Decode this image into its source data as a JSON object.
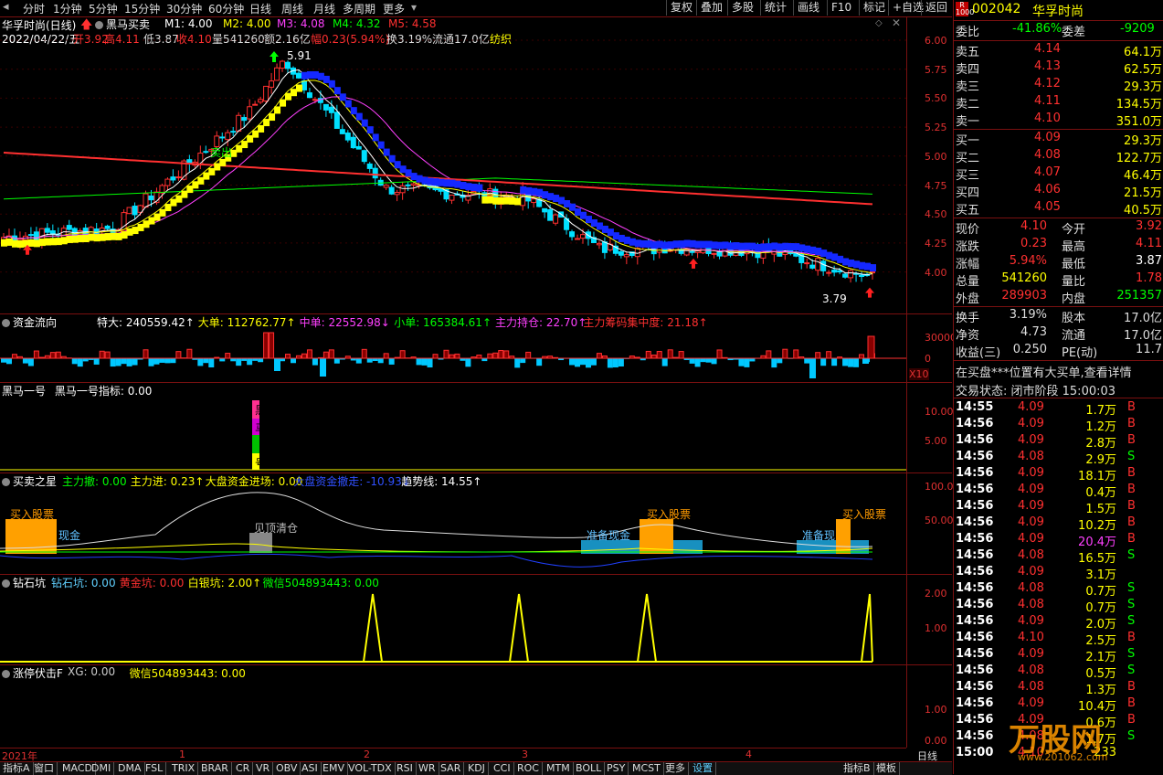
{
  "top_tabs": [
    "分时",
    "1分钟",
    "5分钟",
    "15分钟",
    "30分钟",
    "60分钟",
    "日线",
    "周线",
    "月线",
    "多周期",
    "更多"
  ],
  "top_right_buttons": [
    "复权",
    "叠加",
    "多股",
    "统计",
    "画线",
    "F10",
    "标记",
    "+自选",
    "返回"
  ],
  "stock_title": "华孚时尚(日线)",
  "indicator_name": "黑马买卖",
  "ma_labels": [
    {
      "text": "M1: 4.00",
      "color": "#ffffff"
    },
    {
      "text": "M2: 4.00",
      "color": "#ffff00"
    },
    {
      "text": "M3: 4.08",
      "color": "#ff40ff"
    },
    {
      "text": "M4: 4.32",
      "color": "#00ff00"
    },
    {
      "text": "M5: 4.58",
      "color": "#ff3030"
    }
  ],
  "info_line": {
    "date": "2022/04/22/五",
    "open": "开3.92",
    "high": "高4.11",
    "low": "低3.87",
    "close": "收4.10",
    "vol": "量541260",
    "amount": "额2.16亿",
    "change": "幅0.23(5.94%)",
    "turnover": "换3.19%",
    "float": "流通17.0亿",
    "industry": "纺织"
  },
  "main_axis": [
    "6.00",
    "5.75",
    "5.50",
    "5.25",
    "5.00",
    "4.75",
    "4.50",
    "4.25",
    "4.00"
  ],
  "price_annotations": {
    "high": "5.91",
    "low": "3.79",
    "sell_tag": "卖出"
  },
  "panel_zjlx": {
    "title": "资金流向",
    "items": [
      {
        "text": "特大: 240559.42↑",
        "color": "#ffffff"
      },
      {
        "text": "大单: 112762.77↑",
        "color": "#ffff00"
      },
      {
        "text": "中单: 22552.98↓",
        "color": "#ff40ff"
      },
      {
        "text": "小单: 165384.61↑",
        "color": "#00ff00"
      },
      {
        "text": "主力持仓: 22.70↑",
        "color": "#ff40ff"
      },
      {
        "text": "主力筹码集中度: 21.18↑",
        "color": "#ff3030"
      }
    ],
    "axis": [
      "30000",
      "0"
    ],
    "scale": "X10"
  },
  "panel_hm": {
    "title": "黑马一号",
    "label": "黑马一号指标: 0.00",
    "axis": [
      "10.00",
      "5.00"
    ],
    "tag_chars": [
      "黑",
      "马",
      "号"
    ]
  },
  "panel_mmzx": {
    "title": "买卖之星",
    "items": [
      {
        "text": "主力撤: 0.00",
        "color": "#00ff00"
      },
      {
        "text": "主力进: 0.23↑",
        "color": "#ffff00"
      },
      {
        "text": "大盘资金进场: 0.00",
        "color": "#ffff00"
      },
      {
        "text": "大盘资金撤走: -10.93↓",
        "color": "#3050ff"
      },
      {
        "text": "趋势线: 14.55↑",
        "color": "#ffffff"
      }
    ],
    "axis": [
      "100.00",
      "50.00"
    ],
    "labels": {
      "buy": "买入股票",
      "cash": "准备现金",
      "cash_short": "准备现",
      "cash_frag": "现金",
      "clear": "见顶清仓"
    }
  },
  "panel_zsk": {
    "title": "钻石坑",
    "items": [
      {
        "text": "钻石坑: 0.00",
        "color": "#60d0ff"
      },
      {
        "text": "黄金坑: 0.00",
        "color": "#ff3030"
      },
      {
        "text": "白银坑: 2.00↑",
        "color": "#ffff00"
      },
      {
        "text": "微信504893443: 0.00",
        "color": "#00ff00"
      }
    ],
    "axis": [
      "2.00",
      "1.00"
    ]
  },
  "panel_ztfj": {
    "title": "涨停伏击F",
    "items": [
      {
        "text": "XG: 0.00",
        "color": "#cccccc"
      },
      {
        "text": "微信504893443: 0.00",
        "color": "#ffff00"
      }
    ],
    "axis": [
      "1.00",
      "0.00"
    ]
  },
  "time_scale": {
    "year": "2021年",
    "months": [
      "1",
      "2",
      "3",
      "4"
    ],
    "period": "日线"
  },
  "bottom_tabs": [
    "指标A",
    "窗口",
    "MACD",
    "DMI",
    "DMA",
    "FSL",
    "TRIX",
    "BRAR",
    "CR",
    "VR",
    "OBV",
    "ASI",
    "EMV",
    "VOL-TDX",
    "RSI",
    "WR",
    "SAR",
    "KDJ",
    "CCI",
    "ROC",
    "MTM",
    "BOLL",
    "PSY",
    "MCST",
    "更多",
    "设置",
    "指标B",
    "模板"
  ],
  "right_panel": {
    "code": "002042",
    "name": "华孚时尚",
    "weibi": {
      "label": "委比",
      "value": "-41.86%",
      "label2": "委差",
      "value2": "-9209"
    },
    "sell": [
      {
        "label": "卖五",
        "price": "4.14",
        "vol": "64.1万"
      },
      {
        "label": "卖四",
        "price": "4.13",
        "vol": "62.5万"
      },
      {
        "label": "卖三",
        "price": "4.12",
        "vol": "29.3万"
      },
      {
        "label": "卖二",
        "price": "4.11",
        "vol": "134.5万"
      },
      {
        "label": "卖一",
        "price": "4.10",
        "vol": "351.0万"
      }
    ],
    "buy": [
      {
        "label": "买一",
        "price": "4.09",
        "vol": "29.3万"
      },
      {
        "label": "买二",
        "price": "4.08",
        "vol": "122.7万"
      },
      {
        "label": "买三",
        "price": "4.07",
        "vol": "46.4万"
      },
      {
        "label": "买四",
        "price": "4.06",
        "vol": "21.5万"
      },
      {
        "label": "买五",
        "price": "4.05",
        "vol": "40.5万"
      }
    ],
    "stats": [
      {
        "l1": "现价",
        "v1": "4.10",
        "c1": "#ff3030",
        "l2": "今开",
        "v2": "3.92",
        "c2": "#ff3030"
      },
      {
        "l1": "涨跌",
        "v1": "0.23",
        "c1": "#ff3030",
        "l2": "最高",
        "v2": "4.11",
        "c2": "#ff3030"
      },
      {
        "l1": "涨幅",
        "v1": "5.94%",
        "c1": "#ff3030",
        "l2": "最低",
        "v2": "3.87",
        "c2": "#ffffff"
      },
      {
        "l1": "总量",
        "v1": "541260",
        "c1": "#ffff00",
        "l2": "量比",
        "v2": "1.78",
        "c2": "#ff3030"
      },
      {
        "l1": "外盘",
        "v1": "289903",
        "c1": "#ff3030",
        "l2": "内盘",
        "v2": "251357",
        "c2": "#00ff00"
      }
    ],
    "stats2": [
      {
        "l1": "换手",
        "v1": "3.19%",
        "l2": "股本",
        "v2": "17.0亿"
      },
      {
        "l1": "净资",
        "v1": "4.73",
        "l2": "流通",
        "v2": "17.0亿"
      },
      {
        "l1": "收益(三)",
        "v1": "0.250",
        "l2": "PE(动)",
        "v2": "11.7"
      }
    ],
    "notice": "在买盘***位置有大买单,查看详情",
    "trade_state": "交易状态: 闭市阶段 15:00:03",
    "ticks": [
      {
        "t": "14:55",
        "p": "4.09",
        "v": "1.7万",
        "s": "B"
      },
      {
        "t": "14:56",
        "p": "4.09",
        "v": "1.2万",
        "s": "B"
      },
      {
        "t": "14:56",
        "p": "4.09",
        "v": "2.8万",
        "s": "B"
      },
      {
        "t": "14:56",
        "p": "4.08",
        "v": "2.9万",
        "s": "S"
      },
      {
        "t": "14:56",
        "p": "4.09",
        "v": "18.1万",
        "s": "B"
      },
      {
        "t": "14:56",
        "p": "4.09",
        "v": "0.4万",
        "s": "B"
      },
      {
        "t": "14:56",
        "p": "4.09",
        "v": "1.5万",
        "s": "B"
      },
      {
        "t": "14:56",
        "p": "4.09",
        "v": "10.2万",
        "s": "B"
      },
      {
        "t": "14:56",
        "p": "4.09",
        "v": "20.4万",
        "s": "B"
      },
      {
        "t": "14:56",
        "p": "4.08",
        "v": "16.5万",
        "s": "S"
      },
      {
        "t": "14:56",
        "p": "4.09",
        "v": "3.1万",
        "s": ""
      },
      {
        "t": "14:56",
        "p": "4.08",
        "v": "0.7万",
        "s": "S"
      },
      {
        "t": "14:56",
        "p": "4.08",
        "v": "0.7万",
        "s": "S"
      },
      {
        "t": "14:56",
        "p": "4.09",
        "v": "2.0万",
        "s": "S"
      },
      {
        "t": "14:56",
        "p": "4.10",
        "v": "2.5万",
        "s": "B"
      },
      {
        "t": "14:56",
        "p": "4.09",
        "v": "2.1万",
        "s": "S"
      },
      {
        "t": "14:56",
        "p": "4.08",
        "v": "0.5万",
        "s": "S"
      },
      {
        "t": "14:56",
        "p": "4.08",
        "v": "1.3万",
        "s": "B"
      },
      {
        "t": "14:56",
        "p": "4.09",
        "v": "10.4万",
        "s": "B"
      },
      {
        "t": "14:56",
        "p": "4.09",
        "v": "0.6万",
        "s": "B"
      },
      {
        "t": "14:56",
        "p": "4.08",
        "v": "1.7万",
        "s": "S"
      },
      {
        "t": "15:00",
        "p": "4.10",
        "v": "233",
        "s": ""
      }
    ]
  },
  "watermark": "万股网",
  "watermark_url": "www.201062.com",
  "colors": {
    "up": "#ff3030",
    "down": "#00e0ff",
    "ma1": "#ffffff",
    "ma2": "#ffff00",
    "ma3": "#ff40ff",
    "ma4": "#00ff00",
    "ma5": "#ff3030",
    "border": "#7a1010"
  }
}
